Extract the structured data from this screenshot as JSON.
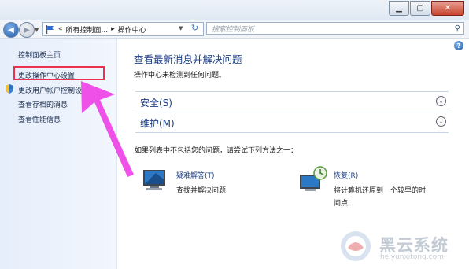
{
  "window": {
    "minimize_icon": "minimize-icon",
    "maximize_icon": "maximize-icon",
    "close_icon": "close-icon"
  },
  "toolbar": {
    "breadcrumb_prefix": "«",
    "breadcrumb_parent": "所有控制面...",
    "breadcrumb_sep": "▸",
    "breadcrumb_current": "操作中心",
    "search_placeholder": "搜索控制面板"
  },
  "sidebar": {
    "items": [
      {
        "label": "控制面板主页"
      },
      {
        "label": "更改操作中心设置"
      },
      {
        "label": "更改用户帐户控制设"
      },
      {
        "label": "查看存档的消息"
      },
      {
        "label": "查看性能信息"
      }
    ]
  },
  "main": {
    "title": "查看最新消息并解决问题",
    "subtitle": "操作中心未检测到任何问题。",
    "sections": [
      {
        "label": "安全(S)"
      },
      {
        "label": "维护(M)"
      }
    ],
    "intro": "如果列表中不包括您的问题，请尝试下列方法之一：",
    "actions": [
      {
        "title": "疑难解答(T)",
        "desc": "查找并解决问题"
      },
      {
        "title": "恢复(R)",
        "desc1": "将计算机还原到一个较早的时",
        "desc2": "间点"
      }
    ]
  },
  "watermark": {
    "brand": "黑云系统",
    "url": "heiyunxitong.com"
  },
  "colors": {
    "link": "#1c3f85",
    "highlight_box": "#e8324e",
    "arrow": "#ee3fe6"
  }
}
